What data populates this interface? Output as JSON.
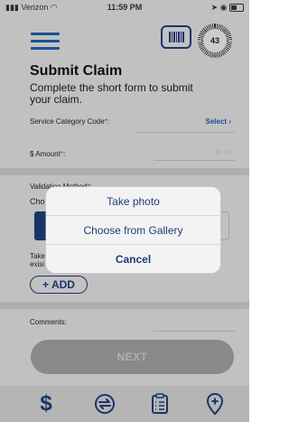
{
  "status_bar": {
    "carrier": "Verizon",
    "time": "11:59 PM"
  },
  "header": {
    "gauge_value": "43"
  },
  "form": {
    "title": "Submit Claim",
    "subtitle": "Complete the short form to submit your claim.",
    "service_category_label": "Service Category Code",
    "select_label": "Select",
    "amount_label": "$ Amount",
    "amount_placeholder": "$0.00",
    "validation_label": "Validation Method",
    "choose_partial": "Cho",
    "take_partial": "Take",
    "exist_partial": "exisi",
    "add_label": "+ ADD",
    "comments_label": "Comments:",
    "next_label": "NEXT"
  },
  "action_sheet": {
    "options": [
      "Take photo",
      "Choose from Gallery"
    ],
    "cancel": "Cancel"
  },
  "colors": {
    "accent": "#1f3c78",
    "link": "#1f5ea8",
    "required": "#e0301e"
  }
}
